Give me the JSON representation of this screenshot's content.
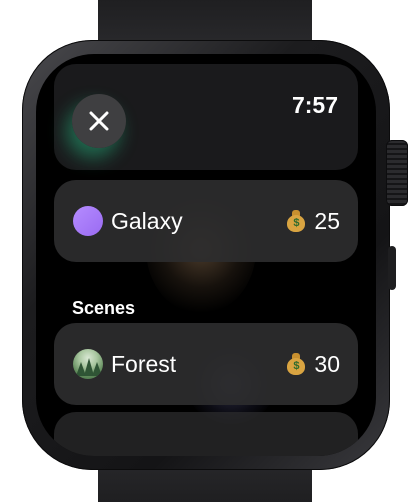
{
  "status_bar": {
    "time": "7:57"
  },
  "header": {
    "close_icon": "close-icon"
  },
  "items": [
    {
      "label": "Galaxy",
      "price": "25",
      "price_icon": "moneybag-icon",
      "swatch_color": "#a57df9"
    }
  ],
  "sections": [
    {
      "title": "Scenes",
      "items": [
        {
          "label": "Forest",
          "price": "30",
          "price_icon": "moneybag-icon",
          "thumbnail": "forest-scene"
        }
      ]
    }
  ],
  "colors": {
    "row_background": "#2c2c2e",
    "text": "#ffffff",
    "accent_glow": "#28c88c"
  }
}
